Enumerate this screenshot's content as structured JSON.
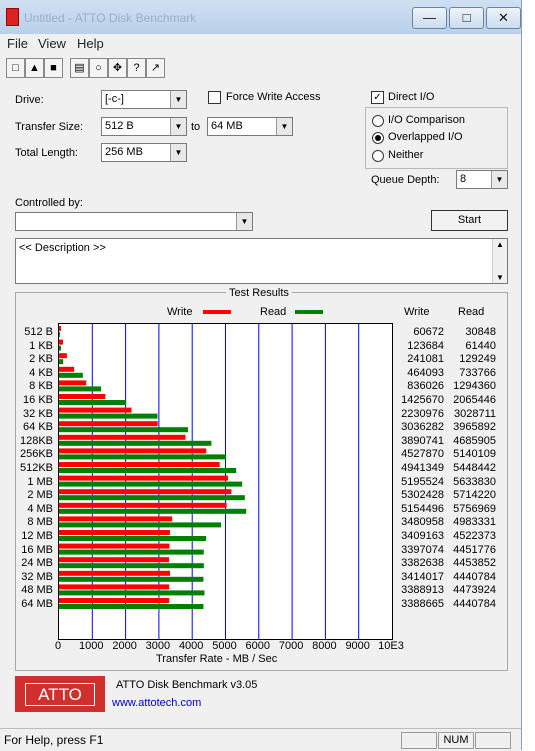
{
  "window": {
    "title": "Untitled - ATTO Disk Benchmark"
  },
  "menu": [
    "File",
    "View",
    "Help"
  ],
  "toolbar_icons": [
    "new-icon",
    "open-icon",
    "save-icon",
    "print-icon",
    "print-preview-icon",
    "move-icon",
    "help-icon",
    "context-help-icon"
  ],
  "form": {
    "drive_label": "Drive:",
    "drive_value": "[-c-]",
    "transfer_size_label": "Transfer Size:",
    "transfer_from": "512 B",
    "to_label": "to",
    "transfer_to": "64 MB",
    "total_length_label": "Total Length:",
    "total_length_value": "256 MB",
    "force_write_access": "Force Write Access",
    "direct_io": "Direct I/O",
    "io_comparison": "I/O Comparison",
    "overlapped_io": "Overlapped I/O",
    "neither": "Neither",
    "queue_depth_label": "Queue Depth:",
    "queue_depth_value": "8",
    "controlled_by_label": "Controlled by:",
    "start_button": "Start",
    "description": "<< Description >>"
  },
  "results": {
    "group_title": "Test Results",
    "write_legend": "Write",
    "read_legend": "Read",
    "write_header": "Write",
    "read_header": "Read",
    "xlabel": "Transfer Rate - MB / Sec",
    "x_ticks": [
      "0",
      "1000",
      "2000",
      "3000",
      "4000",
      "5000",
      "6000",
      "7000",
      "8000",
      "9000",
      "10E3"
    ],
    "colors": {
      "write": "#ff0000",
      "read": "#008000",
      "grid": "#0000ff"
    }
  },
  "chart_data": {
    "type": "bar",
    "xlim": [
      0,
      10000
    ],
    "categories": [
      "512 B",
      "1 KB",
      "2 KB",
      "4 KB",
      "8 KB",
      "16 KB",
      "32 KB",
      "64 KB",
      "128KB",
      "256KB",
      "512KB",
      "1 MB",
      "2 MB",
      "4 MB",
      "8 MB",
      "12 MB",
      "16 MB",
      "24 MB",
      "32 MB",
      "48 MB",
      "64 MB"
    ],
    "series": [
      {
        "name": "Write",
        "values": [
          60672,
          123684,
          241081,
          464093,
          836026,
          1425670,
          2230976,
          3036282,
          3890741,
          4527870,
          4941349,
          5195524,
          5302428,
          5154496,
          3480958,
          3409163,
          3397074,
          3382638,
          3414017,
          3388913,
          3388665
        ]
      },
      {
        "name": "Read",
        "values": [
          30848,
          61440,
          129249,
          733766,
          1294360,
          2065446,
          3028711,
          3965892,
          4685905,
          5140109,
          5448442,
          5633830,
          5714220,
          5756969,
          4983331,
          4522373,
          4451776,
          4453852,
          4440784,
          4473924,
          4440784
        ]
      }
    ]
  },
  "branding": {
    "logo_text": "ATTO",
    "app_name": "ATTO Disk Benchmark v3.05",
    "url": "www.attotech.com"
  },
  "statusbar": {
    "help_text": "For Help, press F1",
    "num": "NUM"
  }
}
